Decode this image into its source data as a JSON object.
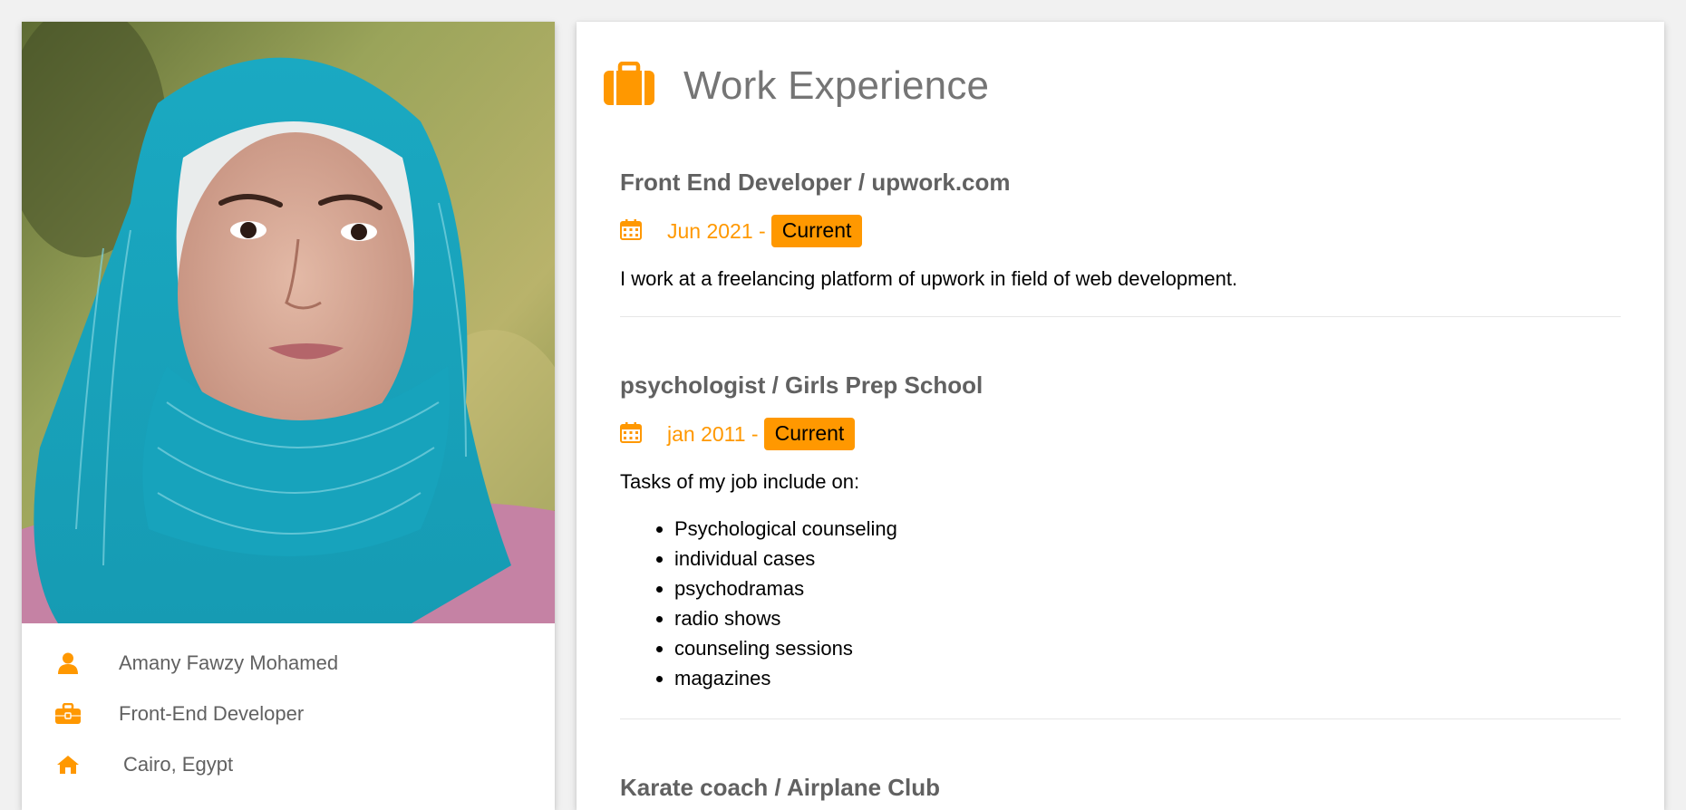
{
  "profile": {
    "name": "Amany Fawzy Mohamed",
    "role": "Front-End Developer",
    "location": "Cairo, Egypt"
  },
  "section": {
    "title": "Work Experience",
    "icon": "suitcase-icon"
  },
  "jobs": [
    {
      "title": "Front End Developer / upwork.com",
      "date": "Jun 2021 -",
      "badge": "Current",
      "description": "I work at a freelancing platform of upwork in field of web development."
    },
    {
      "title": "psychologist / Girls Prep School",
      "date": "jan 2011 -",
      "badge": "Current",
      "description": "Tasks of my job include on:",
      "tasks": [
        "Psychological counseling",
        "individual cases",
        "psychodramas",
        "radio shows",
        "counseling sessions",
        "magazines"
      ]
    },
    {
      "title": "Karate coach / Airplane Club"
    }
  ],
  "colors": {
    "accent": "#ff9800",
    "heading": "#757575",
    "subheading": "#616161",
    "background": "#f1f1f1"
  }
}
